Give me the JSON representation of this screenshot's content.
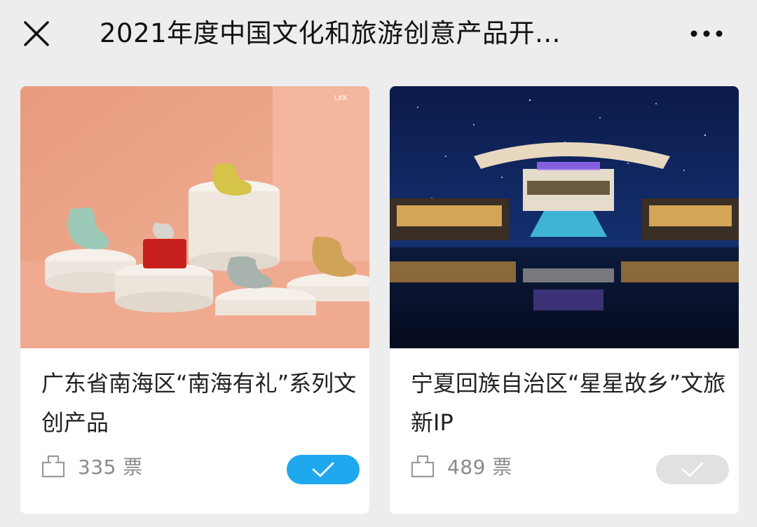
{
  "header": {
    "title": "2021年度中国文化和旅游创意产品开...",
    "close_icon": "close-icon",
    "more_icon": "more-icon"
  },
  "cards": [
    {
      "title": "广东省南海区“南海有礼”系列文创产品",
      "votes": "335 票",
      "voted": true,
      "image": "ceramic-figurines-on-pedestals",
      "button_color": "#20a8ee"
    },
    {
      "title": "宁夏回族自治区“星星故乡”文旅新IP",
      "votes": "489 票",
      "voted": false,
      "image": "night-resort-under-starry-sky",
      "button_color": "#e1e1e1"
    }
  ]
}
